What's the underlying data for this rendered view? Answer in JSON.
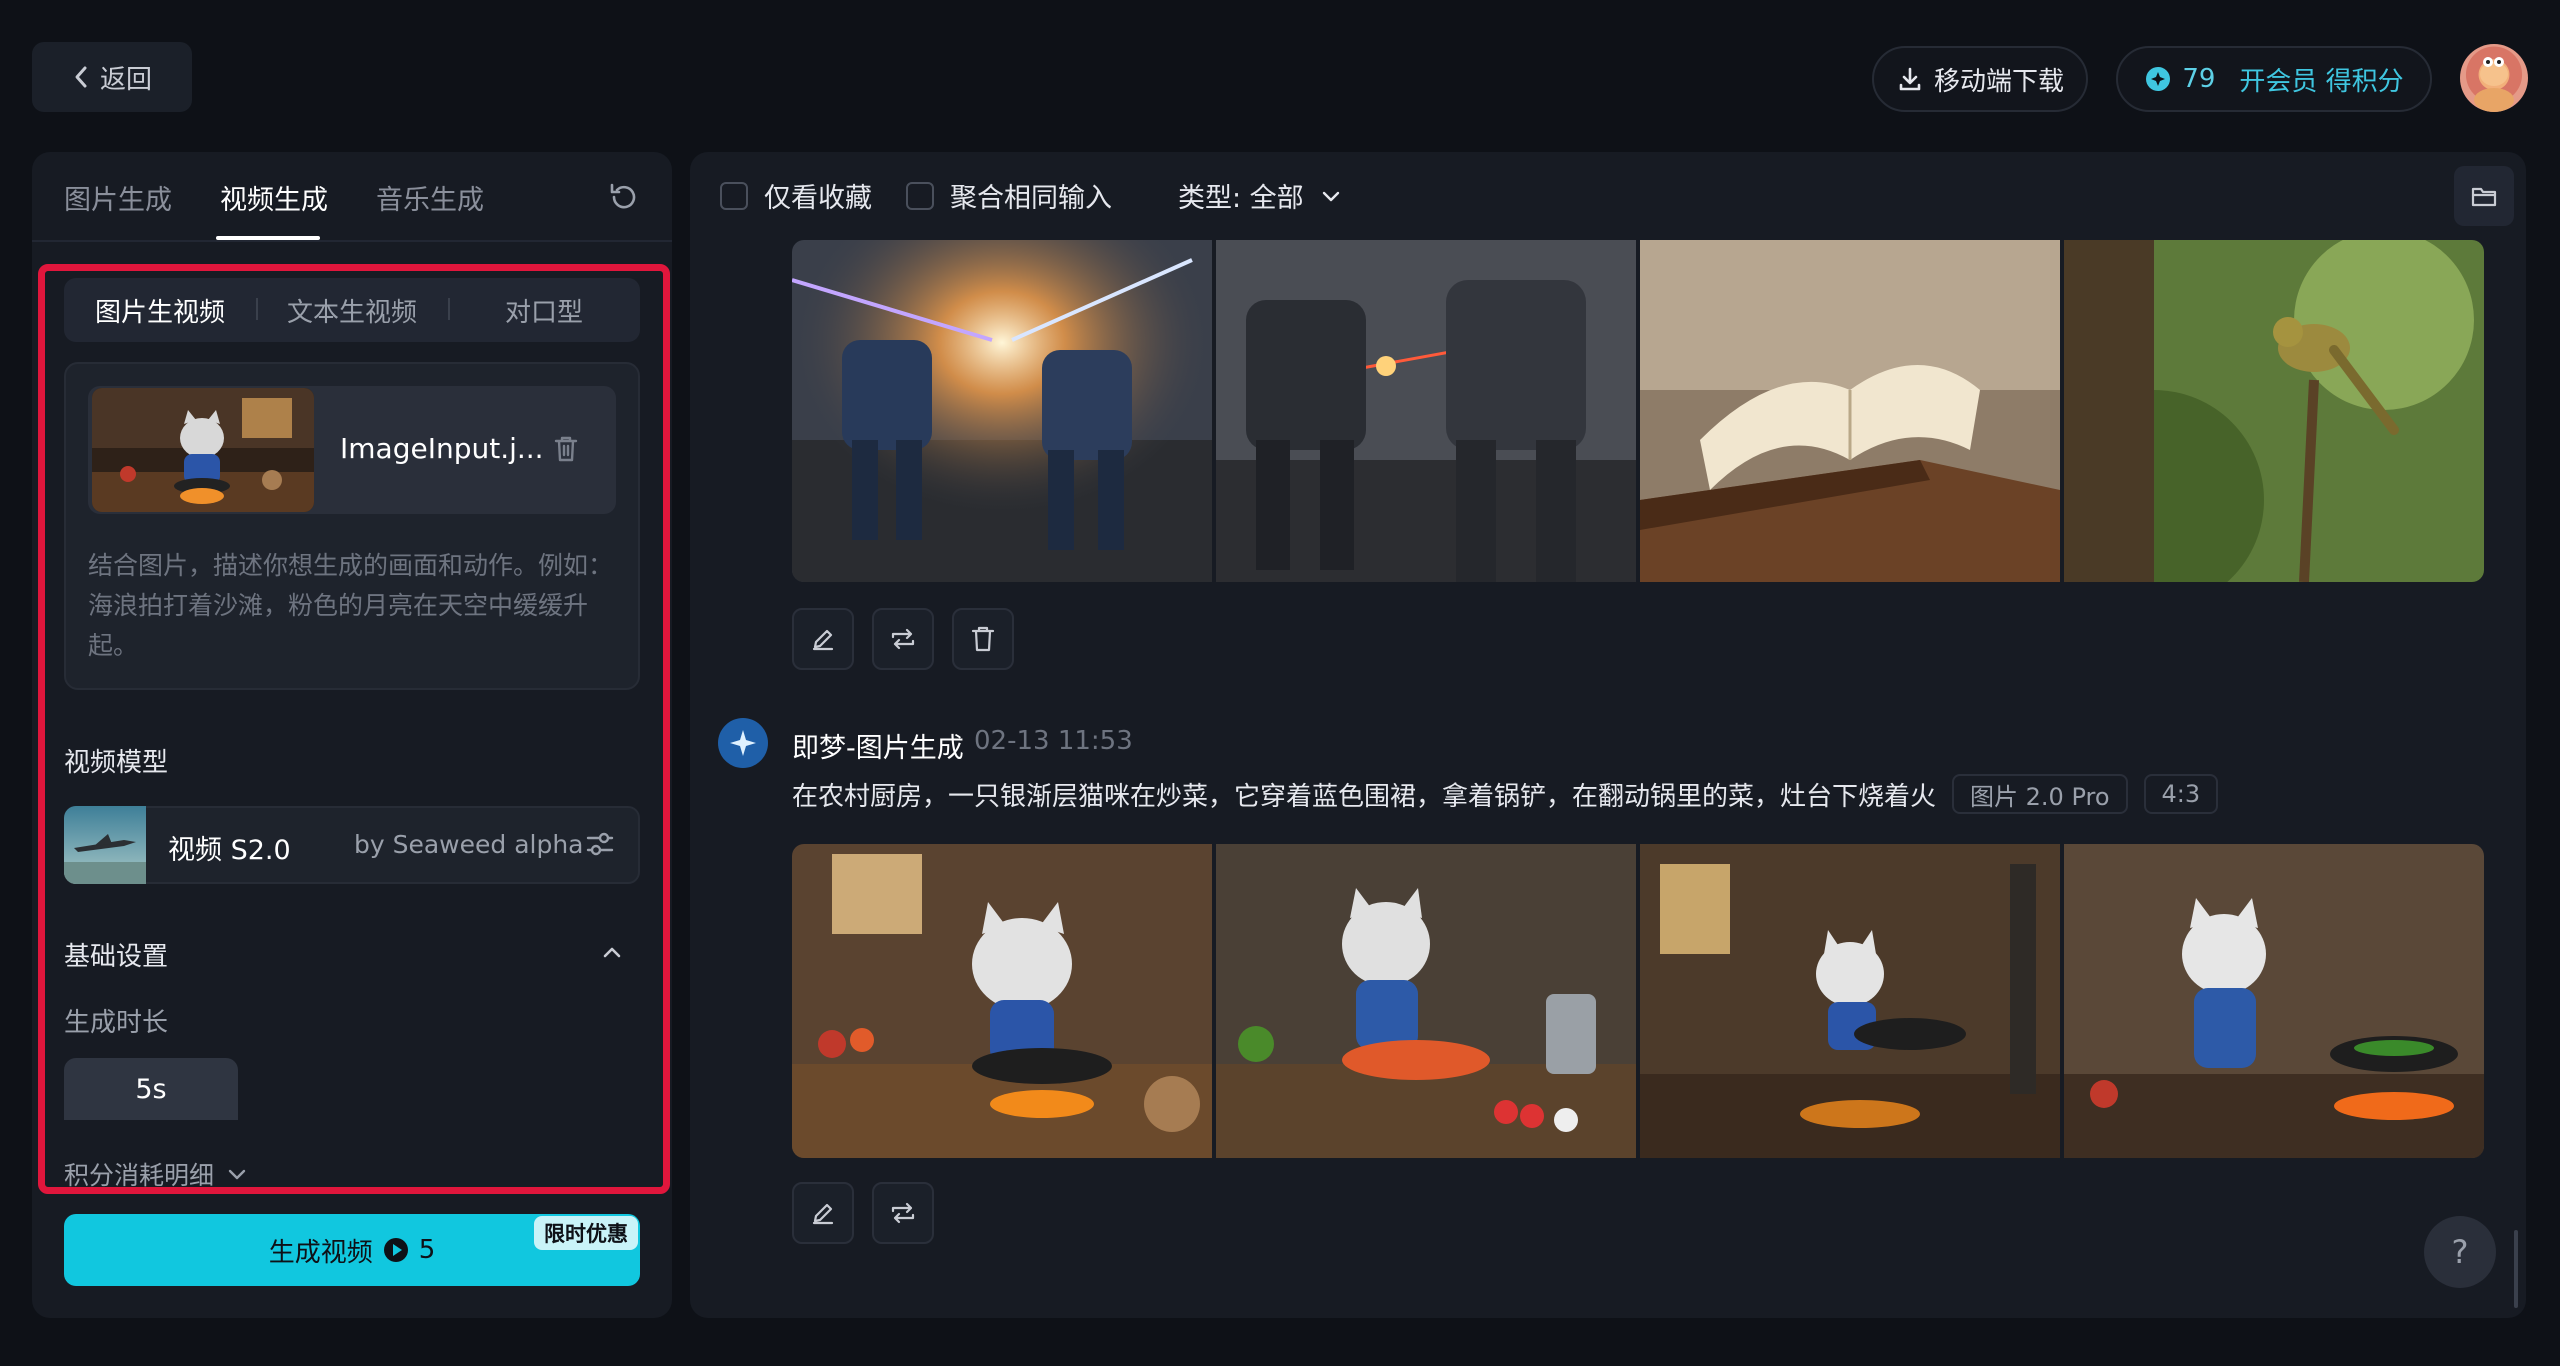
{
  "header": {
    "back_label": "返回",
    "download_label": "移动端下载",
    "credits_count": "79",
    "credits_cta": "开会员 得积分"
  },
  "left_panel": {
    "tabs": [
      {
        "label": "图片生成",
        "active": false
      },
      {
        "label": "视频生成",
        "active": true
      },
      {
        "label": "音乐生成",
        "active": false
      }
    ],
    "sub_tabs": [
      {
        "label": "图片生视频",
        "active": true
      },
      {
        "label": "文本生视频",
        "active": false
      },
      {
        "label": "对口型",
        "active": false
      }
    ],
    "image_input": {
      "file_name": "ImageInput.j..."
    },
    "prompt_placeholder": "结合图片，描述你想生成的画面和动作。例如：海浪拍打着沙滩，粉色的月亮在天空中缓缓升起。",
    "model_section_label": "视频模型",
    "model": {
      "name": "视频 S2.0",
      "by": "by Seaweed alpha"
    },
    "basic_settings_label": "基础设置",
    "duration_label": "生成时长",
    "duration_value": "5s",
    "cost_detail_label": "积分消耗明细",
    "generate_label": "生成视频",
    "generate_cost": "5",
    "promo_badge": "限时优惠"
  },
  "right_panel": {
    "filters": {
      "favorites_label": "仅看收藏",
      "merge_label": "聚合相同输入",
      "type_label": "类型: 全部"
    },
    "generation": {
      "title": "即梦-图片生成",
      "time": "02-13  11:53",
      "prompt": "在农村厨房，一只银渐层猫咪在炒菜，它穿着蓝色围裙，拿着锅铲，在翻动锅里的菜，灶台下烧着火",
      "tags": [
        "图片 2.0 Pro",
        "4:3"
      ]
    },
    "help_label": "?"
  },
  "colors": {
    "accent": "#11c7df",
    "highlight": "#e0163c",
    "background": "#0e1117",
    "panel": "#171b23"
  }
}
